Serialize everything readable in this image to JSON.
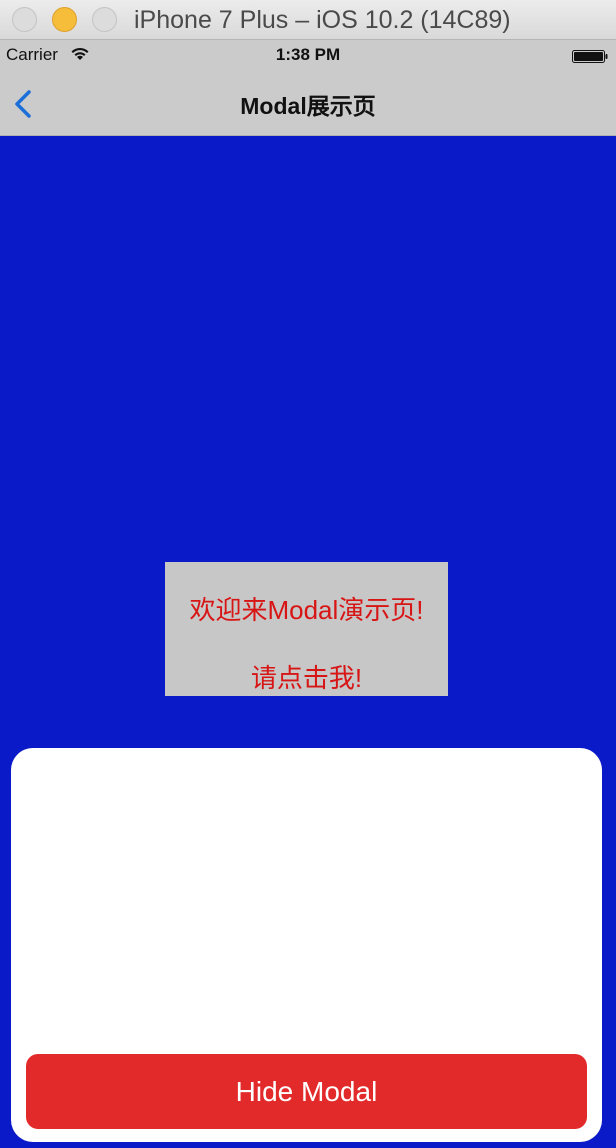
{
  "simulator": {
    "title": "iPhone 7 Plus – iOS 10.2 (14C89)"
  },
  "status_bar": {
    "carrier": "Carrier",
    "time": "1:38 PM"
  },
  "nav_bar": {
    "title": "Modal展示页",
    "accent_color": "#1a6fd8"
  },
  "content": {
    "background_color": "#0a1ac8",
    "welcome_line1": "欢迎来Modal演示页!",
    "welcome_line2": "请点击我!",
    "text_color": "#d81515"
  },
  "modal": {
    "hide_button_label": "Hide Modal",
    "button_color": "#e32a2a"
  }
}
